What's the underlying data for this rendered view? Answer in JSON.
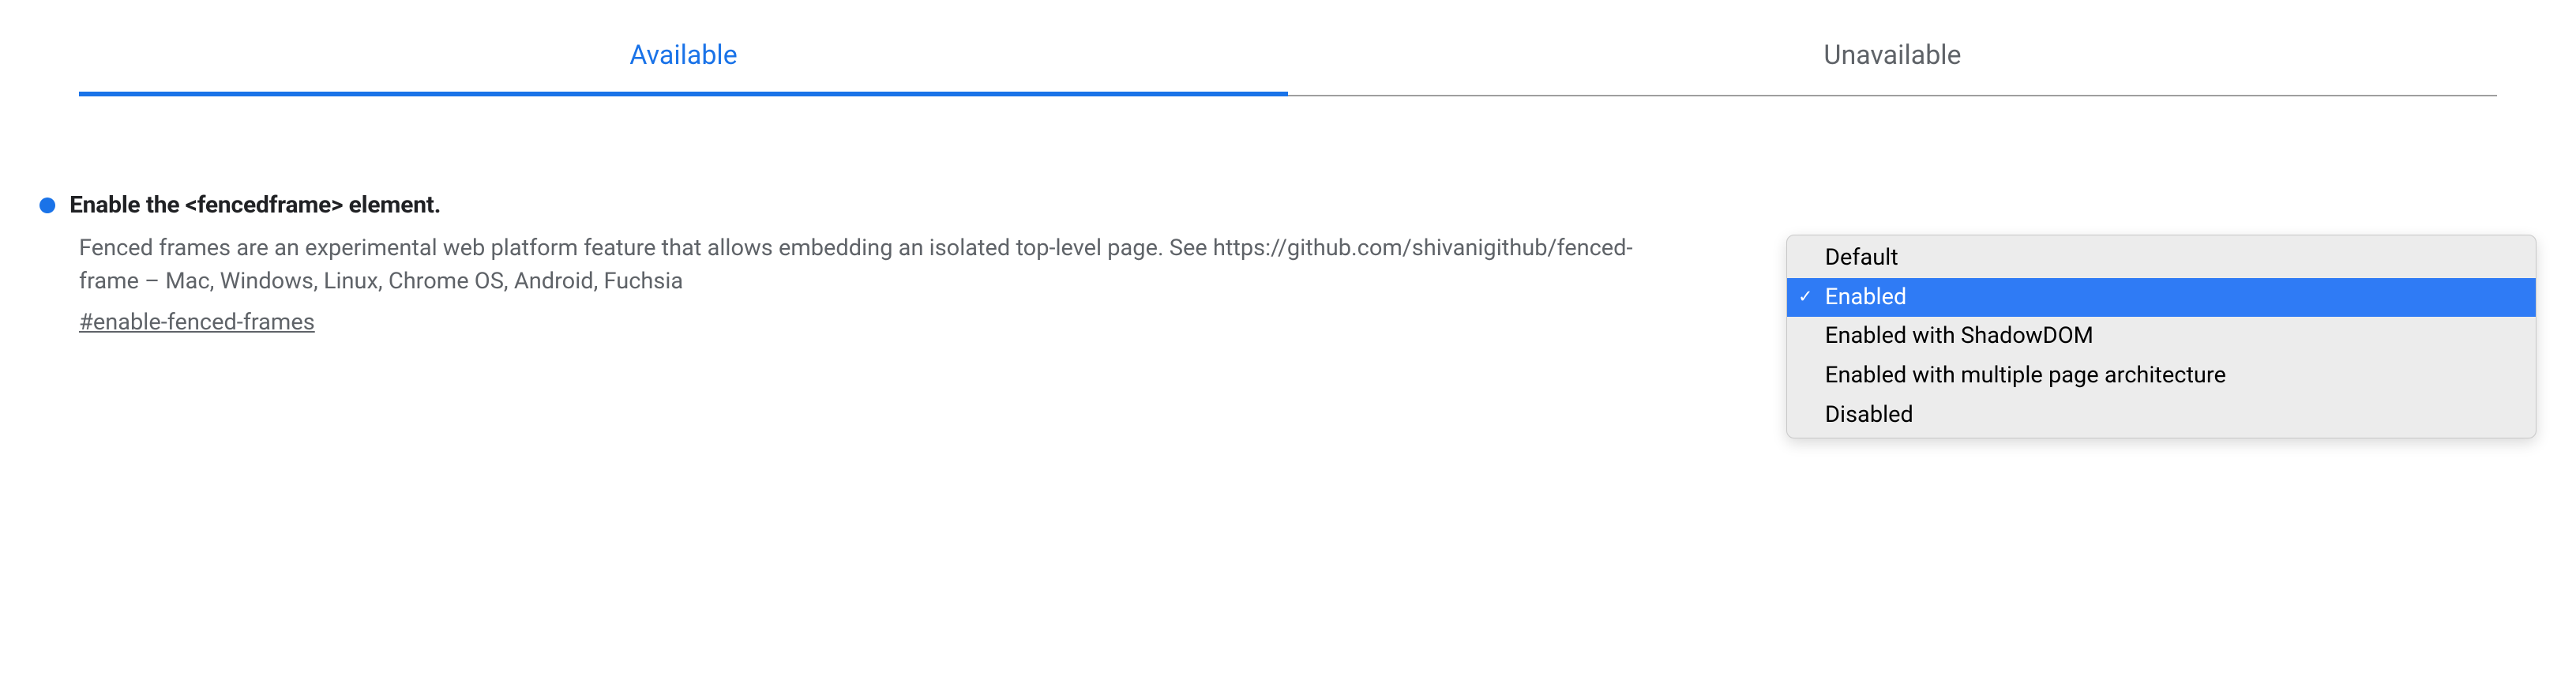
{
  "tabs": {
    "available": "Available",
    "unavailable": "Unavailable"
  },
  "flag": {
    "title": "Enable the <fencedframe> element.",
    "description": "Fenced frames are an experimental web platform feature that allows embedding an isolated top-level page. See https://github.com/shivanigithub/fenced-frame – Mac, Windows, Linux, Chrome OS, Android, Fuchsia",
    "anchor": "#enable-fenced-frames"
  },
  "dropdown": {
    "options": [
      "Default",
      "Enabled",
      "Enabled with ShadowDOM",
      "Enabled with multiple page architecture",
      "Disabled"
    ],
    "selected_index": 1
  }
}
